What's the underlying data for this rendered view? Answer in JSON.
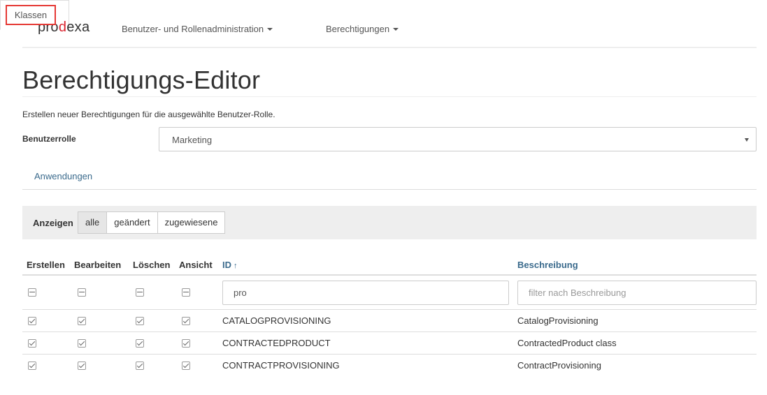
{
  "navbar": {
    "logo_prefix": "pro",
    "logo_accent": "d",
    "logo_suffix": "exa",
    "menu": [
      {
        "label": "Benutzer- und Rollenadministration"
      },
      {
        "label": "Berechtigungen"
      }
    ]
  },
  "page": {
    "title": "Berechtigungs-Editor",
    "subtitle": "Erstellen neuer Berechtigungen für die ausgewählte Benutzer-Rolle."
  },
  "role": {
    "label": "Benutzerrolle",
    "value": "Marketing"
  },
  "tabs": [
    {
      "label": "Anwendungen",
      "active": false
    },
    {
      "label": "Klassen",
      "active": true
    }
  ],
  "filter": {
    "label": "Anzeigen",
    "options": [
      {
        "label": "alle",
        "active": true
      },
      {
        "label": "geändert",
        "active": false
      },
      {
        "label": "zugewiesene",
        "active": false
      }
    ]
  },
  "table": {
    "columns": {
      "create": "Erstellen",
      "edit": "Bearbeiten",
      "delete": "Löschen",
      "view": "Ansicht",
      "id": "ID",
      "description": "Beschreibung"
    },
    "sort_indicator": "↑",
    "id_filter_value": "pro",
    "description_filter_placeholder": "filter nach Beschreibung",
    "rows": [
      {
        "id": "CATALOGPROVISIONING",
        "description": "CatalogProvisioning"
      },
      {
        "id": "CONTRACTEDPRODUCT",
        "description": "ContractedProduct class"
      },
      {
        "id": "CONTRACTPROVISIONING",
        "description": "ContractProvisioning"
      }
    ]
  },
  "colors": {
    "accent_red": "#d9232e",
    "link_blue": "#3a6a8c",
    "highlight_border": "#e53935"
  }
}
